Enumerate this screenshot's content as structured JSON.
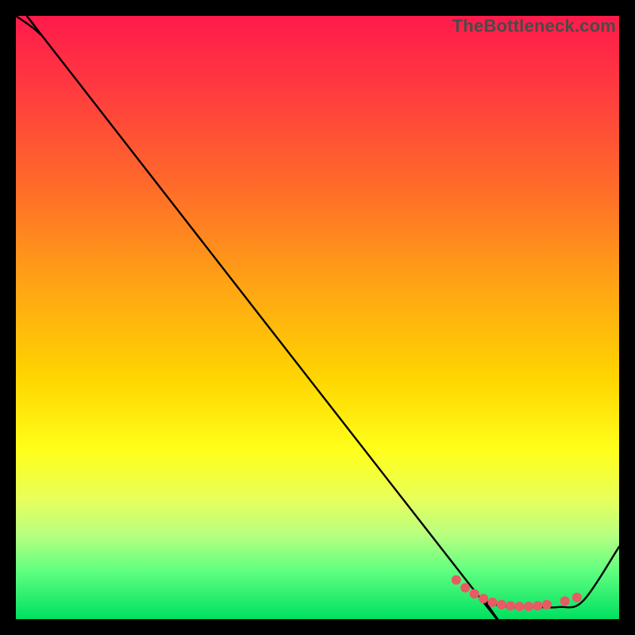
{
  "watermark": "TheBottleneck.com",
  "chart_data": {
    "type": "line",
    "title": "",
    "xlabel": "",
    "ylabel": "",
    "xlim": [
      0,
      100
    ],
    "ylim": [
      0,
      100
    ],
    "series": [
      {
        "name": "curve",
        "x": [
          0,
          4,
          8,
          75,
          78,
          82,
          86,
          90,
          94,
          100
        ],
        "y": [
          100,
          97,
          92,
          6,
          3,
          2,
          2,
          2,
          3,
          12
        ]
      }
    ],
    "markers": {
      "name": "highlight-dots",
      "color": "#e85a64",
      "x": [
        73,
        74.5,
        76,
        77.5,
        79,
        80.5,
        82,
        83.5,
        85,
        86.5,
        88,
        91,
        93
      ],
      "y": [
        6.5,
        5.2,
        4.2,
        3.4,
        2.8,
        2.4,
        2.2,
        2.1,
        2.1,
        2.2,
        2.4,
        3.0,
        3.6
      ]
    },
    "background_gradient": {
      "stops": [
        {
          "pos": 0.0,
          "color": "#ff1a4b"
        },
        {
          "pos": 0.12,
          "color": "#ff3a3f"
        },
        {
          "pos": 0.28,
          "color": "#ff6a2a"
        },
        {
          "pos": 0.45,
          "color": "#ffa514"
        },
        {
          "pos": 0.6,
          "color": "#ffd500"
        },
        {
          "pos": 0.72,
          "color": "#ffff1a"
        },
        {
          "pos": 0.8,
          "color": "#e8ff5a"
        },
        {
          "pos": 0.86,
          "color": "#b8ff80"
        },
        {
          "pos": 0.92,
          "color": "#60ff80"
        },
        {
          "pos": 1.0,
          "color": "#00e060"
        }
      ]
    }
  }
}
